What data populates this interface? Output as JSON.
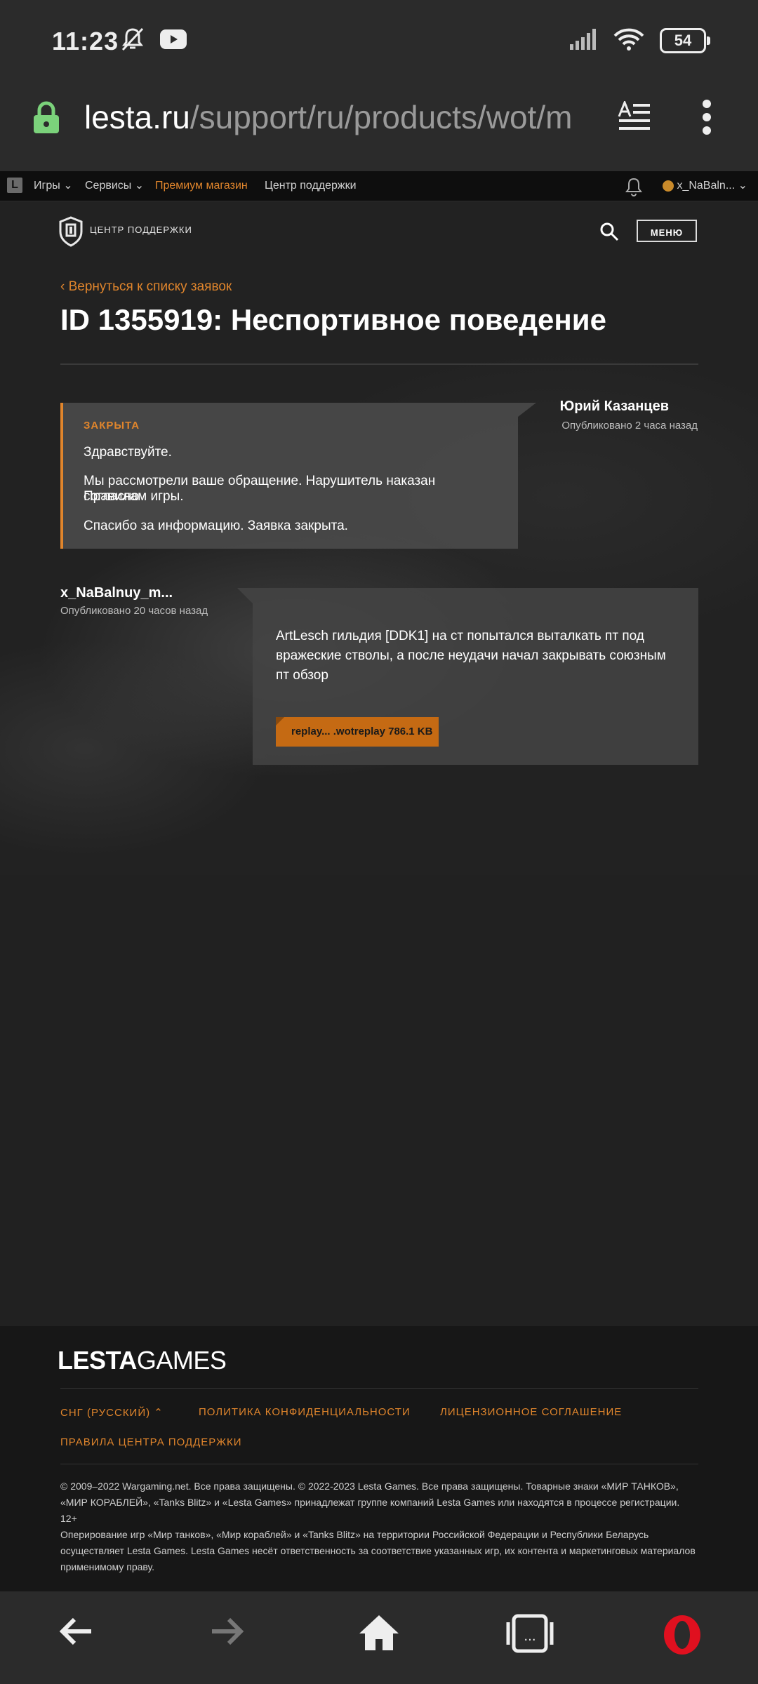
{
  "status_bar": {
    "time": "11:23",
    "battery": "54",
    "icons": [
      "mute-icon",
      "youtube-icon",
      "signal-icon",
      "wifi-icon",
      "battery-icon"
    ]
  },
  "browser": {
    "url_host": "lesta.ru",
    "url_path": "/support/ru/products/wot/m"
  },
  "top_nav": {
    "logo": "L",
    "games": "Игры",
    "services": "Сервисы",
    "premium": "Премиум магазин",
    "support": "Центр поддержки",
    "user": "x_NaBaln..."
  },
  "support_header": {
    "title": "ЦЕНТР ПОДДЕРЖКИ",
    "menu_label": "МЕНЮ"
  },
  "ticket": {
    "back_link": "Вернуться к списку заявок",
    "title": "ID 1355919: Неспортивное поведение"
  },
  "reply": {
    "status": "ЗАКРЫТА",
    "greeting": "Здравствуйте.",
    "body_line1": "Мы рассмотрели ваше обращение. Нарушитель наказан согласно",
    "body_line2": "Правилам игры.",
    "closing": "Спасибо за информацию. Заявка закрыта.",
    "author": "Юрий Казанцев",
    "time": "Опубликовано 2 часа назад"
  },
  "message": {
    "author": "x_NaBalnuy_m...",
    "time": "Опубликовано 20 часов назад",
    "text": "ArtLesch гильдия [DDK1] на ст попытался выталкать пт под вражеские стволы, а после неудачи начал закрывать союзным пт обзор",
    "attachment": "replay... .wotreplay  786.1 KB"
  },
  "footer": {
    "logo_bold": "LESTA",
    "logo_rest": "GAMES",
    "region": "СНГ (РУССКИЙ)",
    "privacy": "ПОЛИТИКА КОНФИДЕНЦИАЛЬНОСТИ",
    "license": "ЛИЦЕНЗИОННОЕ СОГЛАШЕНИЕ",
    "rules": "ПРАВИЛА ЦЕНТРА ПОДДЕРЖКИ",
    "copyright": "© 2009–2022 Wargaming.net. Все права защищены. © 2022-2023 Lesta Games. Все права защищены. Товарные знаки «МИР ТАНКОВ», «МИР КОРАБЛЕЙ», «Tanks Blitz» и «Lesta Games» принадлежат группе компаний Lesta Games или находятся в процессе регистрации.",
    "age": "12+",
    "operator": "Оперирование игр «Мир танков», «Мир кораблей» и «Tanks Blitz» на территории Российской Федерации и Республики Беларусь осуществляет Lesta Games. Lesta Games несёт ответственность за соответствие указанных игр, их контента и маркетинговых материалов применимому праву."
  },
  "colors": {
    "accent": "#e0852c",
    "attachment": "#c56a13",
    "background": "#212121"
  }
}
